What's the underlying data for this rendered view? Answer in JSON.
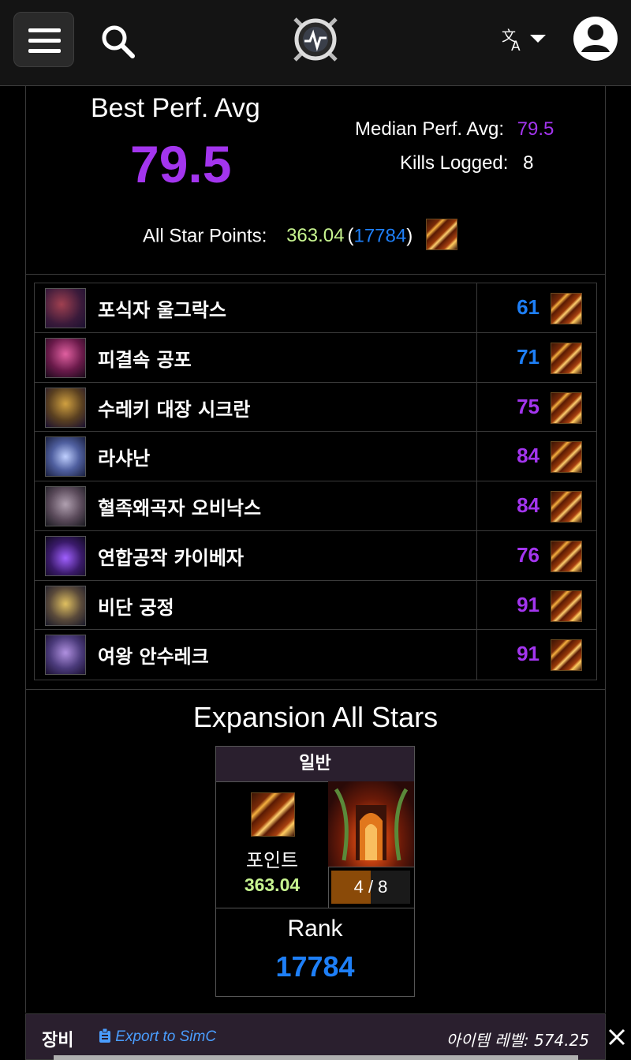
{
  "header": {
    "menu_icon": "hamburger-menu-icon",
    "search_icon": "search-icon",
    "logo_icon": "warcraftlogs-logo-icon",
    "language_icon": "translate-icon",
    "account_icon": "user-avatar-icon"
  },
  "summary": {
    "best_label": "Best Perf. Avg",
    "best_value": "79.5",
    "median_label": "Median Perf. Avg:",
    "median_value": "79.5",
    "kills_label": "Kills Logged:",
    "kills_value": "8",
    "allstar_label": "All Star Points:",
    "allstar_points": "363.04",
    "allstar_open": "(",
    "allstar_rank": "17784",
    "allstar_close": ")"
  },
  "bosses": [
    {
      "name": "포식자 울그락스",
      "score": "61",
      "color": "#1e7ff7"
    },
    {
      "name": "피결속 공포",
      "score": "71",
      "color": "#1e7ff7"
    },
    {
      "name": "수레키 대장 시크란",
      "score": "75",
      "color": "#a335ee"
    },
    {
      "name": "라샤난",
      "score": "84",
      "color": "#a335ee"
    },
    {
      "name": "혈족왜곡자 오비낙스",
      "score": "84",
      "color": "#a335ee"
    },
    {
      "name": "연합공작 카이베자",
      "score": "76",
      "color": "#a335ee"
    },
    {
      "name": "비단 궁정",
      "score": "91",
      "color": "#a335ee"
    },
    {
      "name": "여왕 안수레크",
      "score": "91",
      "color": "#a335ee"
    }
  ],
  "expansion": {
    "title": "Expansion All Stars",
    "difficulty": "일반",
    "points_label": "포인트",
    "points_value": "363.04",
    "progress_text": "4 / 8",
    "progress_fraction": 0.5,
    "rank_label": "Rank",
    "rank_value": "17784"
  },
  "gear": {
    "title": "장비",
    "export_label": "Export to SimC",
    "item_level": "아이템 레벨: 574.25"
  },
  "colors": {
    "epic": "#a335ee",
    "rare": "#1e7ff7",
    "points": "#c7f490"
  }
}
